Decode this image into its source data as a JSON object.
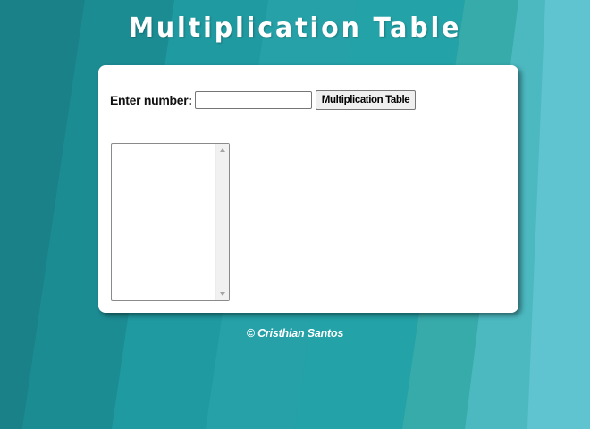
{
  "page": {
    "title": "Multiplication Table",
    "footer": "© Cristhian Santos"
  },
  "form": {
    "label": "Enter number:",
    "input_value": "",
    "input_placeholder": "",
    "button_label": "Multiplication Table"
  },
  "output": {
    "value": ""
  },
  "colors": {
    "background": "#1f9aa0",
    "card": "#ffffff",
    "title_text": "#ffffff"
  },
  "icons": {
    "scroll_up": "scroll-up-arrow-icon",
    "scroll_down": "scroll-down-arrow-icon"
  }
}
